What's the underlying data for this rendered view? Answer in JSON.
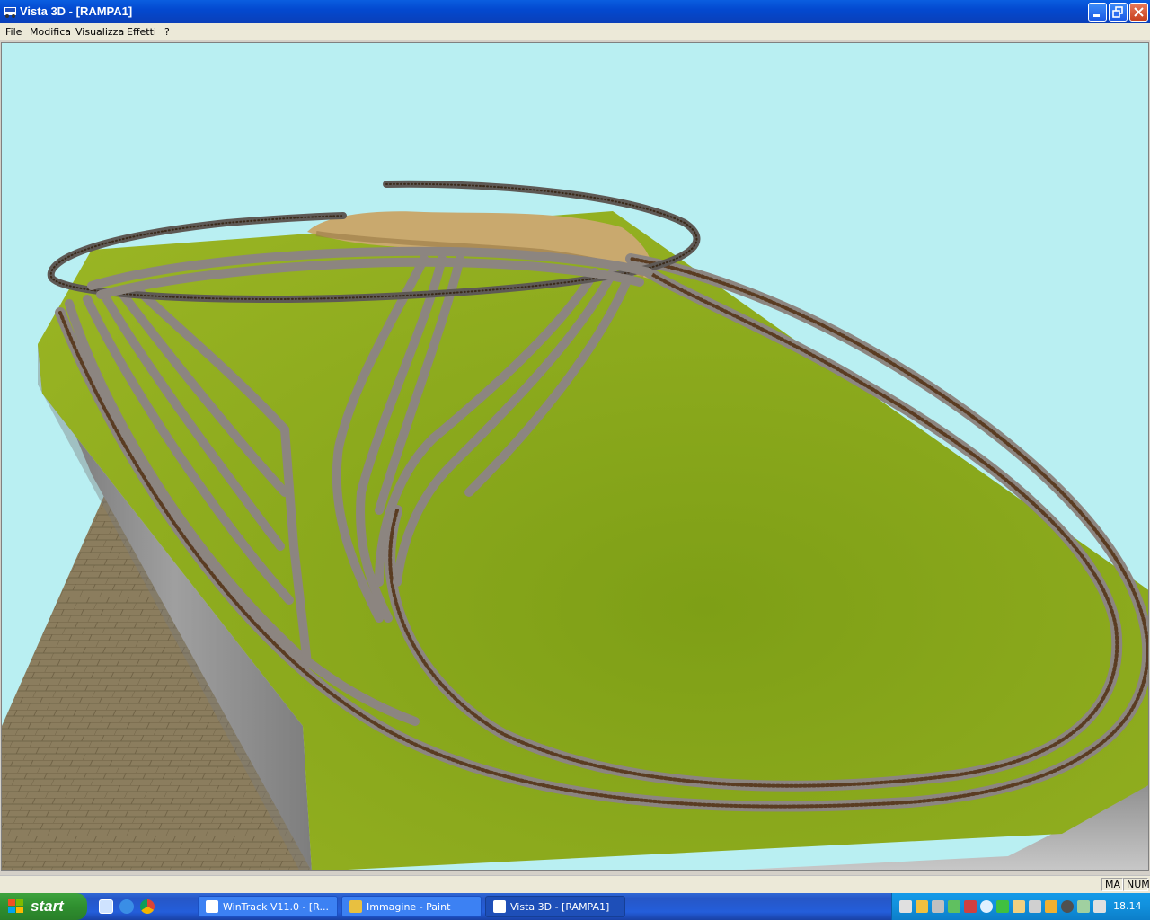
{
  "window": {
    "title": "Vista 3D - [RAMPA1]",
    "icon": "train-3d-icon"
  },
  "menu": {
    "items": [
      "File",
      "Modifica",
      "Visualizza",
      "Effetti",
      "?"
    ]
  },
  "viewport": {
    "description_icon": "3d-layout-scene",
    "colors": {
      "sky": "#b9eff2",
      "grass": "#8aa81a",
      "track": "#8c8580",
      "ties": "#6b4a2a",
      "wall": "#9a9a9a",
      "floor": "#8b7d5e"
    }
  },
  "statusbar": {
    "cells": [
      "MA",
      "NUM"
    ]
  },
  "taskbar": {
    "start_label": "start",
    "quick_launch": [
      "desktop-icon",
      "internet-explorer-icon",
      "chrome-icon"
    ],
    "tasks": [
      {
        "label": "WinTrack  V11.0 - [R...",
        "icon": "wintrack-icon",
        "active": false
      },
      {
        "label": "Immagine - Paint",
        "icon": "paint-icon",
        "active": false
      },
      {
        "label": "Vista 3D - [RAMPA1]",
        "icon": "train-3d-icon",
        "active": true
      }
    ],
    "clock": "18.14"
  }
}
